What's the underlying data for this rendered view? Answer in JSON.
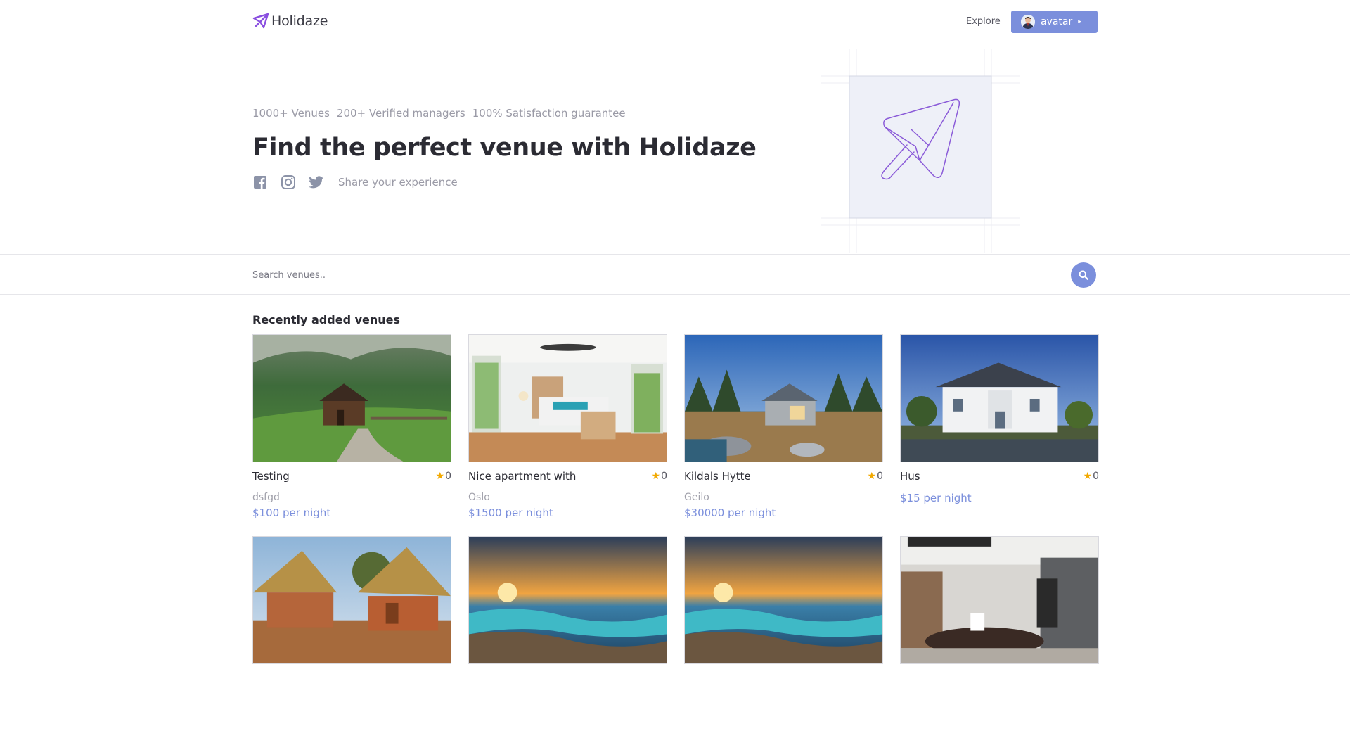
{
  "header": {
    "brand": "Holidaze",
    "nav_explore": "Explore",
    "user_label": "avatar",
    "caret": "▸",
    "accent": "#7b8fdc",
    "brand_color": "#8a4fe0"
  },
  "hero": {
    "stats": [
      "1000+ Venues",
      "200+ Verified managers",
      "100% Satisfaction guarantee"
    ],
    "title": "Find the perfect venue with Holidaze",
    "social_icons": [
      "facebook-icon",
      "instagram-icon",
      "twitter-icon"
    ],
    "share_text": "Share your experience"
  },
  "search": {
    "placeholder": "Search venues.."
  },
  "venues": {
    "section_title": "Recently added venues",
    "star": "★",
    "items": [
      {
        "name": "Testing",
        "rating": "0",
        "location": "dsfgd",
        "price": "$100 per night",
        "image": "mountain-cabin"
      },
      {
        "name": "Nice apartment with",
        "rating": "0",
        "location": "Oslo",
        "price": "$1500 per night",
        "image": "bedroom"
      },
      {
        "name": "Kildals Hytte",
        "rating": "0",
        "location": "Geilo",
        "price": "$30000 per night",
        "image": "modern-cabin"
      },
      {
        "name": "Hus",
        "rating": "0",
        "location": "",
        "price": "$15 per night",
        "image": "white-villa"
      },
      {
        "name": "",
        "rating": "",
        "location": "",
        "price": "",
        "image": "thatched-huts"
      },
      {
        "name": "",
        "rating": "",
        "location": "",
        "price": "",
        "image": "beach-sunset"
      },
      {
        "name": "",
        "rating": "",
        "location": "",
        "price": "",
        "image": "beach-sunset"
      },
      {
        "name": "",
        "rating": "",
        "location": "",
        "price": "",
        "image": "interior-kitchen"
      }
    ]
  }
}
